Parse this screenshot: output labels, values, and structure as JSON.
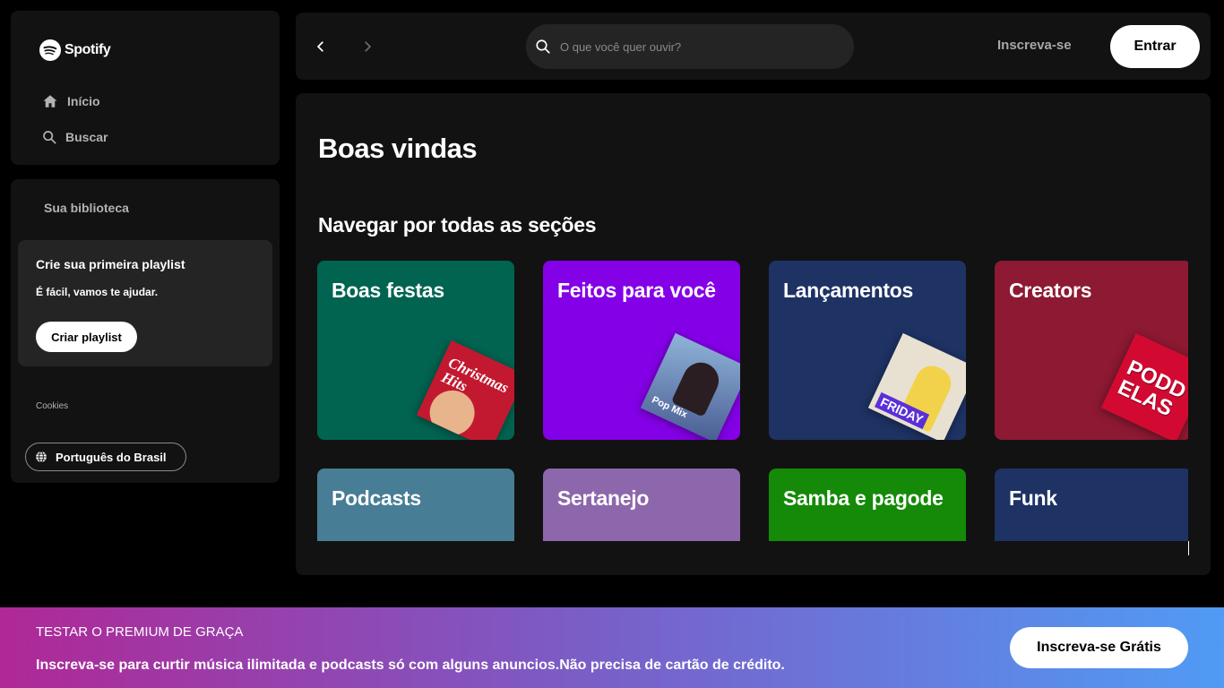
{
  "app": {
    "name": "Spotify"
  },
  "nav": {
    "home_label": "Início",
    "search_label": "Buscar"
  },
  "library": {
    "title": "Sua biblioteca",
    "playlist_card": {
      "title": "Crie sua primeira playlist",
      "subtitle": "É fácil, vamos te ajudar.",
      "button_label": "Criar playlist"
    },
    "cookies_label": "Cookies",
    "language_label": "Português do Brasil"
  },
  "topbar": {
    "search_placeholder": "O que você quer ouvir?",
    "signup_label": "Inscreva-se",
    "login_label": "Entrar"
  },
  "main": {
    "welcome": "Boas vindas",
    "section_title": "Navegar por todas as seções",
    "cards": [
      {
        "label": "Boas festas",
        "color": "#006450",
        "cover_text": "Christmas Hits",
        "cover_color": "#c21930"
      },
      {
        "label": "Feitos para você",
        "color": "#8400e7",
        "cover_text": "Pop Mix",
        "cover_color": "#5c86b8"
      },
      {
        "label": "Lançamentos",
        "color": "#1e3264",
        "cover_text": "FRIDAY",
        "cover_color": "#e8e1d2"
      },
      {
        "label": "Creators",
        "color": "#8d1932",
        "cover_text": "PODDELAS",
        "cover_color": "#d20a32"
      },
      {
        "label": "Podcasts",
        "color": "#477d95"
      },
      {
        "label": "Sertanejo",
        "color": "#8d67ab"
      },
      {
        "label": "Samba e pagode",
        "color": "#148a08"
      },
      {
        "label": "Funk",
        "color": "#1e3264"
      }
    ]
  },
  "banner": {
    "title": "TESTAR O PREMIUM DE GRAÇA",
    "subtitle": "Inscreva-se para curtir música ilimitada e podcasts só com alguns anuncios.Não precisa de cartão de crédito.",
    "button_label": "Inscreva-se Grátis"
  },
  "colors": {
    "background": "#000000",
    "panel": "#121212",
    "accent_gradient_start": "#af2896",
    "accent_gradient_end": "#509bf5"
  }
}
